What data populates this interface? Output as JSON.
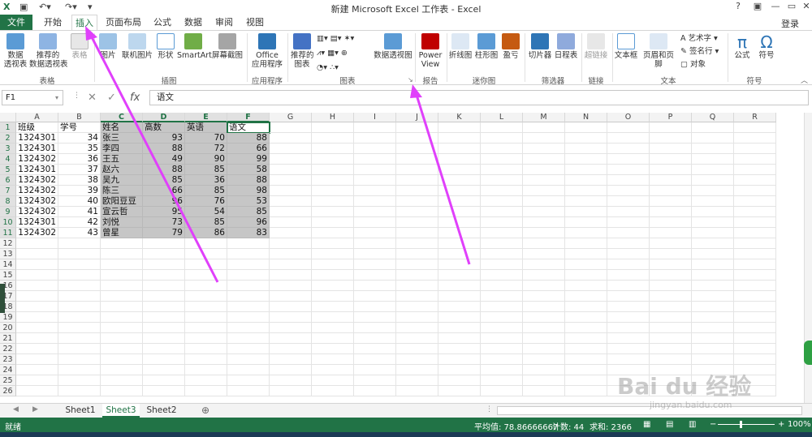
{
  "window": {
    "title": "新建 Microsoft Excel 工作表 - Excel",
    "login": "登录",
    "help": "?",
    "minimize": "—",
    "restore": "▭",
    "close": "✕"
  },
  "tabs": [
    "文件",
    "开始",
    "插入",
    "页面布局",
    "公式",
    "数据",
    "审阅",
    "视图"
  ],
  "ribbon": {
    "buttons": {
      "pivot": "数据\n透视表",
      "rec_pivot": "推荐的\n数据透视表",
      "table": "表格",
      "pictures": "图片",
      "online_pictures": "联机图片",
      "shapes": "形状",
      "smartart": "SmartArt",
      "screenshot": "屏幕截图",
      "office_apps": "Office\n应用程序",
      "rec_charts": "推荐的\n图表",
      "pivot_chart": "数据透视图",
      "power_view": "Power\nView",
      "line": "折线图",
      "column": "柱形图",
      "winloss": "盈亏",
      "slicer": "切片器",
      "timeline": "日程表",
      "hyperlink": "超链接",
      "textbox": "文本框",
      "header_footer": "页眉和页脚",
      "wordart": "艺术字 ▾",
      "signature": "签名行 ▾",
      "object": "对象",
      "formula": "公式",
      "symbol": "符号"
    },
    "groups": {
      "tables": "表格",
      "illustrations": "插图",
      "apps": "应用程序",
      "charts": "图表",
      "reports": "报告",
      "sparklines": "迷你图",
      "filters": "筛选器",
      "links": "链接",
      "text": "文本",
      "symbols": "符号"
    }
  },
  "formula_bar": {
    "name_box": "F1",
    "fx": "fx",
    "value": "语文"
  },
  "columns": [
    "A",
    "B",
    "C",
    "D",
    "E",
    "F",
    "G",
    "H",
    "I",
    "J",
    "K",
    "L",
    "M",
    "N",
    "O",
    "P",
    "Q",
    "R"
  ],
  "rows": [
    [
      "班级",
      "学号",
      "姓名",
      "高数",
      "英语",
      "语文"
    ],
    [
      "1324301",
      "34",
      "张三",
      "93",
      "70",
      "88"
    ],
    [
      "1324301",
      "35",
      "李四",
      "88",
      "72",
      "66"
    ],
    [
      "1324302",
      "36",
      "王五",
      "49",
      "90",
      "99"
    ],
    [
      "1324301",
      "37",
      "赵六",
      "88",
      "85",
      "58"
    ],
    [
      "1324302",
      "38",
      "吴九",
      "85",
      "36",
      "88"
    ],
    [
      "1324302",
      "39",
      "陈三",
      "66",
      "85",
      "98"
    ],
    [
      "1324302",
      "40",
      "欧阳豆豆",
      "96",
      "76",
      "53"
    ],
    [
      "1324302",
      "41",
      "宣云哲",
      "95",
      "54",
      "85"
    ],
    [
      "1324301",
      "42",
      "刘悦",
      "73",
      "85",
      "96"
    ],
    [
      "1324302",
      "43",
      "曾星",
      "79",
      "86",
      "83"
    ]
  ],
  "row_numbers": [
    "1",
    "2",
    "3",
    "4",
    "5",
    "6",
    "7",
    "8",
    "9",
    "10",
    "11",
    "12",
    "13",
    "14",
    "15",
    "16",
    "17",
    "18",
    "19",
    "20",
    "21",
    "22",
    "23",
    "24",
    "25",
    "26"
  ],
  "sheets": [
    "Sheet1",
    "Sheet3",
    "Sheet2"
  ],
  "active_sheet": "Sheet3",
  "status": {
    "mode": "就绪",
    "average": "平均值: 78.86666667",
    "count": "计数: 44",
    "sum": "求和: 2366",
    "zoom": "100%"
  },
  "watermark": {
    "text": "Bai du 经验",
    "url": "jingyan.baidu.com"
  },
  "colors": {
    "excel_green": "#217346",
    "annotation": "#e040fb",
    "selection": "#c6c6c6"
  }
}
